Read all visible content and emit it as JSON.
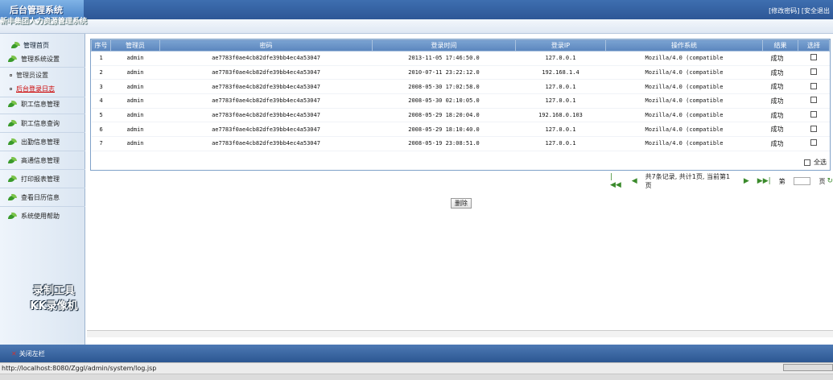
{
  "header": {
    "logo": "后台管理系统",
    "change_password": "[修改密码]",
    "logout": "[安全退出"
  },
  "system_name": "新丰集团人力资源管理系统",
  "sidebar": {
    "home": "管理首页",
    "groups": [
      {
        "label": "管理系统设置"
      },
      {
        "label": "职工信息管理"
      },
      {
        "label": "职工信息查询"
      },
      {
        "label": "出勤信息管理"
      },
      {
        "label": "高通信息管理"
      },
      {
        "label": "打印报表管理"
      },
      {
        "label": "查看日历信息"
      },
      {
        "label": "系统使用帮助"
      }
    ],
    "subitems": [
      {
        "label": "管理员设置"
      },
      {
        "label": "后台登录日志"
      }
    ]
  },
  "watermark": {
    "line1": "录制工具",
    "line2": "KK录像机"
  },
  "table": {
    "columns": [
      "序号",
      "管理员",
      "密码",
      "登录时间",
      "登录IP",
      "操作系统",
      "结果",
      "选择"
    ],
    "rows": [
      {
        "no": "1",
        "admin": "admin",
        "password": "ae7783f0ae4cb82dfe39bb4ec4a53047",
        "time": "2013-11-05 17:46:50.0",
        "ip": "127.0.0.1",
        "os": "Mozilla/4.0 (compatible",
        "result": "成功"
      },
      {
        "no": "2",
        "admin": "admin",
        "password": "ae7783f0ae4cb82dfe39bb4ec4a53047",
        "time": "2010-07-11 23:22:12.0",
        "ip": "192.168.1.4",
        "os": "Mozilla/4.0 (compatible",
        "result": "成功"
      },
      {
        "no": "3",
        "admin": "admin",
        "password": "ae7783f0ae4cb82dfe39bb4ec4a53047",
        "time": "2008-05-30 17:02:58.0",
        "ip": "127.0.0.1",
        "os": "Mozilla/4.0 (compatible",
        "result": "成功"
      },
      {
        "no": "4",
        "admin": "admin",
        "password": "ae7783f0ae4cb82dfe39bb4ec4a53047",
        "time": "2008-05-30 02:10:05.0",
        "ip": "127.0.0.1",
        "os": "Mozilla/4.0 (compatible",
        "result": "成功"
      },
      {
        "no": "5",
        "admin": "admin",
        "password": "ae7783f0ae4cb82dfe39bb4ec4a53047",
        "time": "2008-05-29 18:20:04.0",
        "ip": "192.168.0.103",
        "os": "Mozilla/4.0 (compatible",
        "result": "成功"
      },
      {
        "no": "6",
        "admin": "admin",
        "password": "ae7783f0ae4cb82dfe39bb4ec4a53047",
        "time": "2008-05-29 18:10:40.0",
        "ip": "127.0.0.1",
        "os": "Mozilla/4.0 (compatible",
        "result": "成功"
      },
      {
        "no": "7",
        "admin": "admin",
        "password": "ae7783f0ae4cb82dfe39bb4ec4a53047",
        "time": "2008-05-19 23:08:51.0",
        "ip": "127.0.0.1",
        "os": "Mozilla/4.0 (compatible",
        "result": "成功"
      }
    ],
    "select_all": "全选"
  },
  "pager": {
    "summary": "共7条记录, 共计1页, 当前第1页",
    "goto_prefix": "第",
    "goto_suffix": "页"
  },
  "delete_button": "删除",
  "footer": {
    "close_left": "关闭左栏"
  },
  "status_bar": {
    "url": "http://localhost:8080/Zggl/admin/system/log.jsp"
  },
  "icons": [
    "leaf-icon",
    "first-page-icon",
    "prev-page-icon",
    "next-page-icon",
    "last-page-icon",
    "go-icon",
    "close-icon"
  ],
  "colors": {
    "header_blue": "#2d5796",
    "table_header": "#5b86bd",
    "active_link": "#cc0000"
  }
}
